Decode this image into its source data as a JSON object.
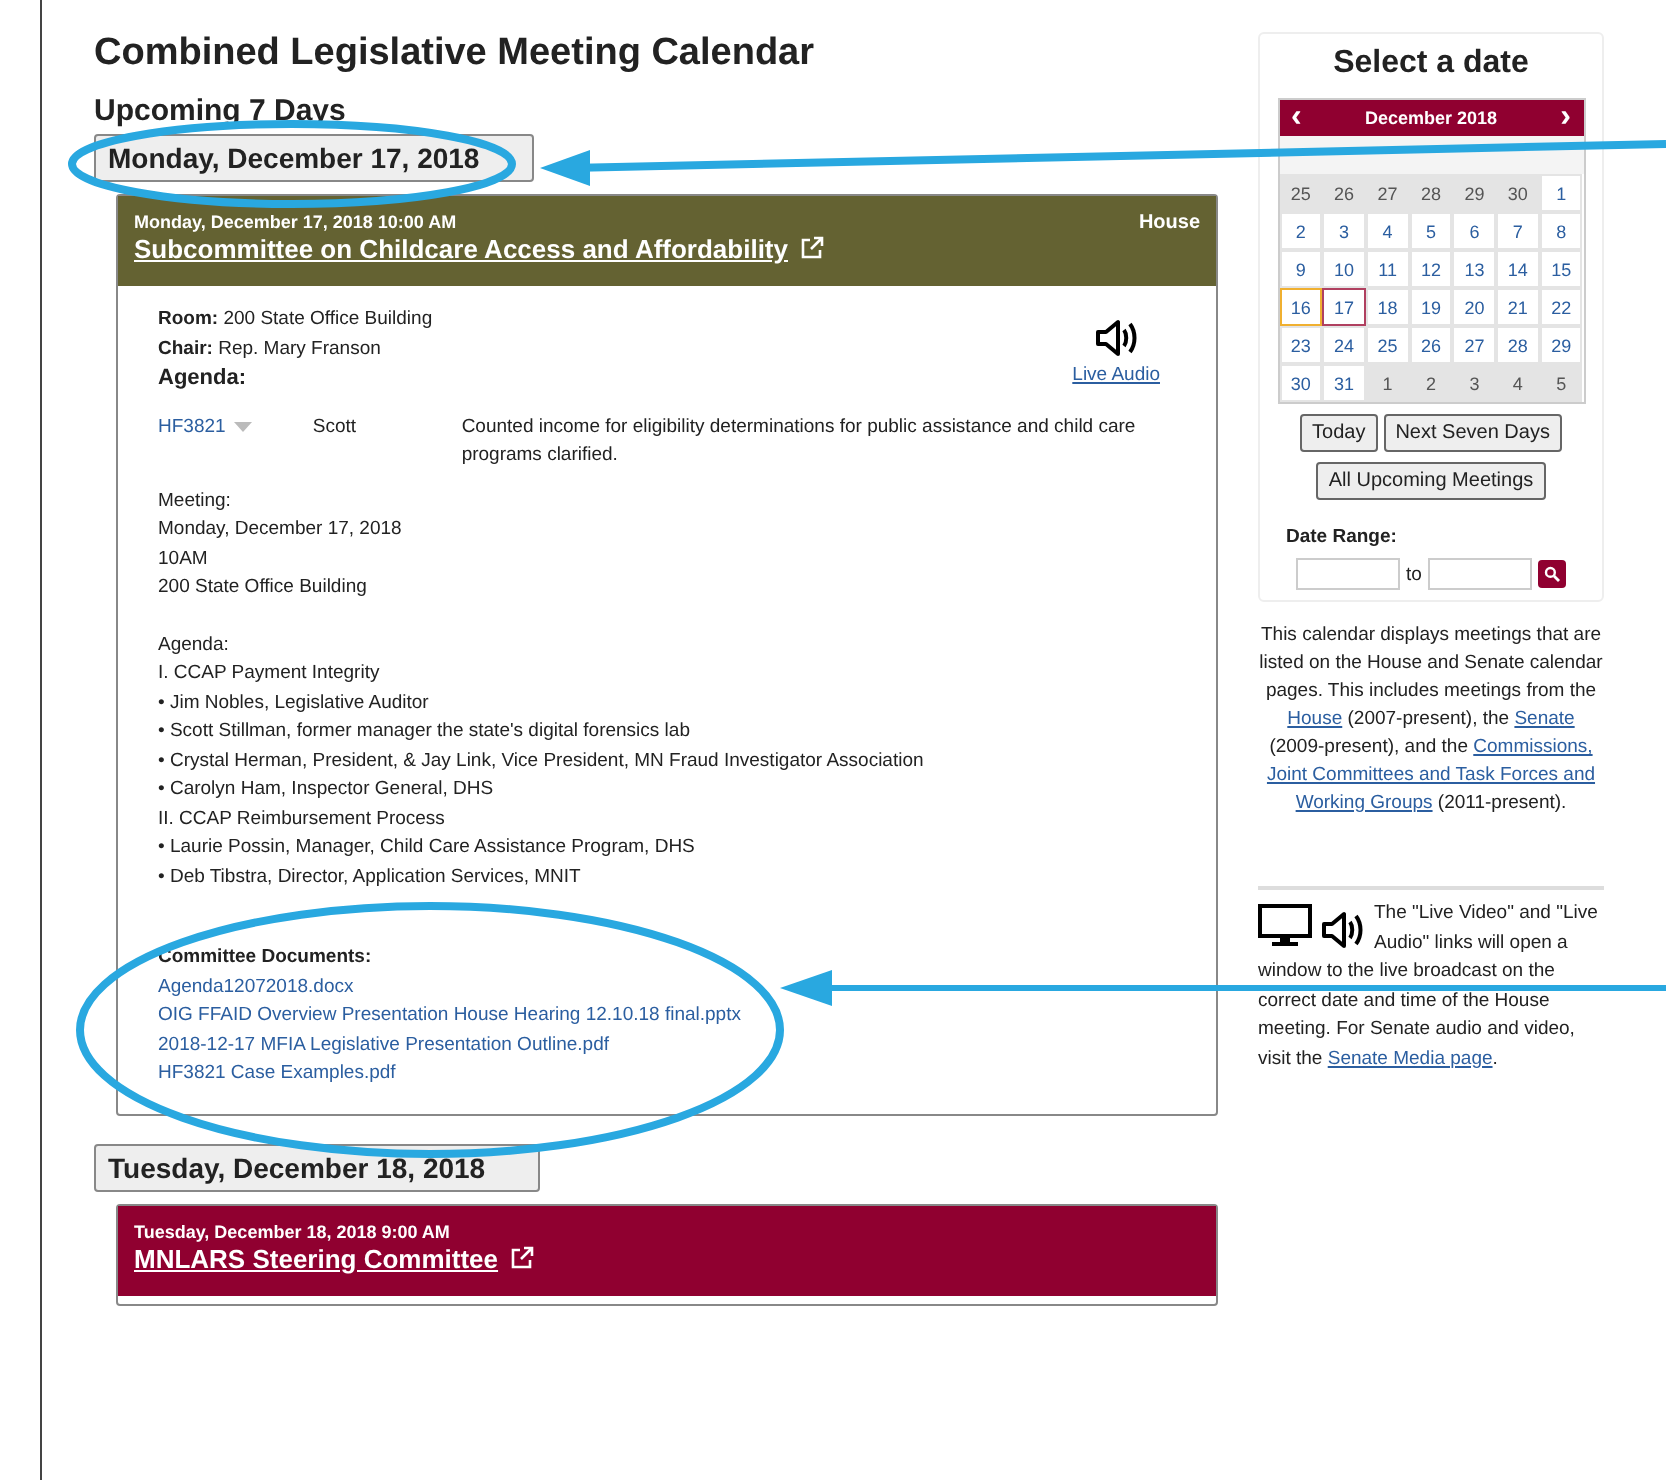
{
  "page": {
    "title": "Combined Legislative Meeting Calendar",
    "subtitle": "Upcoming 7 Days"
  },
  "days": [
    {
      "label": "Monday, December 17, 2018",
      "meetings": [
        {
          "color": "#646232",
          "datetime": "Monday, December 17, 2018 10:00 AM",
          "chamber": "House",
          "title": "Subcommittee on Childcare Access and Affordability",
          "details": [
            {
              "label": "Room:",
              "value": "200 State Office Building"
            },
            {
              "label": "Chair:",
              "value": "Rep. Mary Franson"
            }
          ],
          "agenda_label": "Agenda:",
          "live_audio": "Live Audio",
          "bills": [
            {
              "number": "HF3821",
              "author": "Scott",
              "description": "Counted income for eligibility determinations for public assistance and child care programs clarified."
            }
          ],
          "notes": [
            [
              "Meeting:",
              "Monday, December 17, 2018",
              "10AM",
              "200 State Office Building"
            ],
            [
              "Agenda:",
              "I. CCAP Payment Integrity",
              "• Jim Nobles, Legislative Auditor",
              "• Scott Stillman, former manager the state's digital forensics lab",
              "• Crystal Herman, President, & Jay Link, Vice President, MN Fraud Investigator Association",
              "• Carolyn Ham, Inspector General, DHS",
              "II. CCAP Reimbursement Process",
              "• Laurie Possin, Manager, Child Care Assistance Program, DHS",
              "• Deb Tibstra, Director, Application Services, MNIT"
            ]
          ],
          "documents_label": "Committee Documents:",
          "documents": [
            "Agenda12072018.docx",
            "OIG FFAID Overview Presentation House Hearing 12.10.18 final.pptx",
            "2018-12-17 MFIA Legislative Presentation Outline.pdf",
            "HF3821 Case Examples.pdf"
          ]
        }
      ]
    },
    {
      "label": "Tuesday, December 18, 2018",
      "meetings": [
        {
          "color": "#900030",
          "datetime": "Tuesday, December 18, 2018 9:00 AM",
          "title": "MNLARS Steering Committee"
        }
      ]
    }
  ],
  "sidebar": {
    "title": "Select a date",
    "month": "December 2018",
    "prev": "‹",
    "next": "›",
    "weeks": [
      [
        {
          "day": "25",
          "muted": true,
          "today": false,
          "selected": false
        },
        {
          "day": "26",
          "muted": true,
          "today": false,
          "selected": false
        },
        {
          "day": "27",
          "muted": true,
          "today": false,
          "selected": false
        },
        {
          "day": "28",
          "muted": true,
          "today": false,
          "selected": false
        },
        {
          "day": "29",
          "muted": true,
          "today": false,
          "selected": false
        },
        {
          "day": "30",
          "muted": true,
          "today": false,
          "selected": false
        },
        {
          "day": "1",
          "muted": false,
          "today": false,
          "selected": false
        }
      ],
      [
        {
          "day": "2",
          "muted": false,
          "today": false,
          "selected": false
        },
        {
          "day": "3",
          "muted": false,
          "today": false,
          "selected": false
        },
        {
          "day": "4",
          "muted": false,
          "today": false,
          "selected": false
        },
        {
          "day": "5",
          "muted": false,
          "today": false,
          "selected": false
        },
        {
          "day": "6",
          "muted": false,
          "today": false,
          "selected": false
        },
        {
          "day": "7",
          "muted": false,
          "today": false,
          "selected": false
        },
        {
          "day": "8",
          "muted": false,
          "today": false,
          "selected": false
        }
      ],
      [
        {
          "day": "9",
          "muted": false,
          "today": false,
          "selected": false
        },
        {
          "day": "10",
          "muted": false,
          "today": false,
          "selected": false
        },
        {
          "day": "11",
          "muted": false,
          "today": false,
          "selected": false
        },
        {
          "day": "12",
          "muted": false,
          "today": false,
          "selected": false
        },
        {
          "day": "13",
          "muted": false,
          "today": false,
          "selected": false
        },
        {
          "day": "14",
          "muted": false,
          "today": false,
          "selected": false
        },
        {
          "day": "15",
          "muted": false,
          "today": false,
          "selected": false
        }
      ],
      [
        {
          "day": "16",
          "muted": false,
          "today": true,
          "selected": false
        },
        {
          "day": "17",
          "muted": false,
          "today": false,
          "selected": true
        },
        {
          "day": "18",
          "muted": false,
          "today": false,
          "selected": false
        },
        {
          "day": "19",
          "muted": false,
          "today": false,
          "selected": false
        },
        {
          "day": "20",
          "muted": false,
          "today": false,
          "selected": false
        },
        {
          "day": "21",
          "muted": false,
          "today": false,
          "selected": false
        },
        {
          "day": "22",
          "muted": false,
          "today": false,
          "selected": false
        }
      ],
      [
        {
          "day": "23",
          "muted": false,
          "today": false,
          "selected": false
        },
        {
          "day": "24",
          "muted": false,
          "today": false,
          "selected": false
        },
        {
          "day": "25",
          "muted": false,
          "today": false,
          "selected": false
        },
        {
          "day": "26",
          "muted": false,
          "today": false,
          "selected": false
        },
        {
          "day": "27",
          "muted": false,
          "today": false,
          "selected": false
        },
        {
          "day": "28",
          "muted": false,
          "today": false,
          "selected": false
        },
        {
          "day": "29",
          "muted": false,
          "today": false,
          "selected": false
        }
      ],
      [
        {
          "day": "30",
          "muted": false,
          "today": false,
          "selected": false
        },
        {
          "day": "31",
          "muted": false,
          "today": false,
          "selected": false
        },
        {
          "day": "1",
          "muted": true,
          "today": false,
          "selected": false
        },
        {
          "day": "2",
          "muted": true,
          "today": false,
          "selected": false
        },
        {
          "day": "3",
          "muted": true,
          "today": false,
          "selected": false
        },
        {
          "day": "4",
          "muted": true,
          "today": false,
          "selected": false
        },
        {
          "day": "5",
          "muted": true,
          "today": false,
          "selected": false
        }
      ]
    ],
    "button_rows": [
      [
        "Today",
        "Next Seven Days"
      ],
      [
        "All Upcoming Meetings"
      ]
    ],
    "date_range": {
      "label": "Date Range:",
      "separator": "to"
    },
    "info": [
      {
        "kind": "text",
        "text": "This calendar displays meetings that are listed on the House and Senate calendar pages. This includes meetings from the "
      },
      {
        "kind": "link",
        "text": "House"
      },
      {
        "kind": "text",
        "text": " (2007-present), the "
      },
      {
        "kind": "link",
        "text": "Senate"
      },
      {
        "kind": "text",
        "text": " (2009-present), and the "
      },
      {
        "kind": "link",
        "text": "Commissions,"
      },
      {
        "kind": "link",
        "text": "Joint Committees and Task Forces and"
      },
      {
        "kind": "link",
        "text": "Working Groups"
      },
      {
        "kind": "text",
        "text": " (2011-present)."
      }
    ],
    "media_note": [
      {
        "kind": "text",
        "text": "The \"Live Video\" and \"Live Audio\" links will open a window to the live broadcast on the correct date and time of the House meeting. For Senate audio and video, visit the "
      },
      {
        "kind": "link",
        "text": "Senate Media page"
      },
      {
        "kind": "text",
        "text": "."
      }
    ]
  }
}
